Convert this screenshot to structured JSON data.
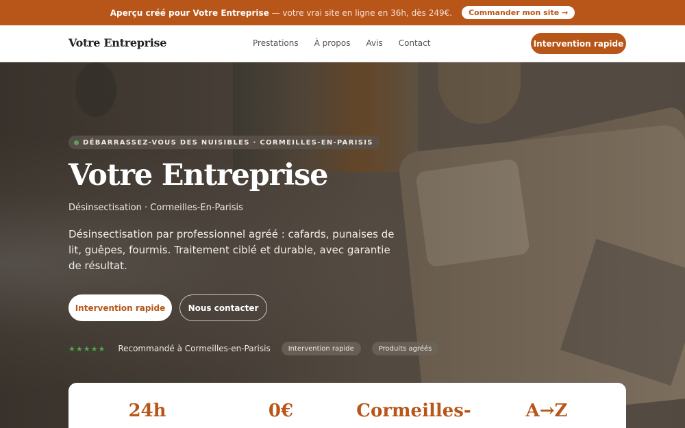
{
  "promo": {
    "lead": "Aperçu créé pour Votre Entreprise",
    "text": " — votre vrai site en ligne en 36h, dès 249€.",
    "cta": "Commander mon site →"
  },
  "nav": {
    "brand": "Votre Entreprise",
    "items": [
      "Prestations",
      "À propos",
      "Avis",
      "Contact"
    ],
    "cta": "Intervention rapide"
  },
  "hero": {
    "eyebrow": "DÉBARRASSEZ-VOUS DES NUISIBLES · CORMEILLES-EN-PARISIS",
    "title": "Votre Entreprise",
    "subtitle": "Désinsectisation · Cormeilles-En-Parisis",
    "description": "Désinsectisation par professionnel agréé : cafards, punaises de lit, guêpes, fourmis. Traitement ciblé et durable, avec garantie de résultat.",
    "primary_cta": "Intervention rapide",
    "secondary_cta": "Nous contacter",
    "stars": "★★★★★",
    "trust_text": "Recommandé à Cormeilles-en-Parisis",
    "chips": [
      "Intervention rapide",
      "Produits agréés"
    ]
  },
  "stats": [
    "24h",
    "0€",
    "Cormeilles-",
    "A→Z"
  ],
  "colors": {
    "accent": "#b8561a",
    "star": "#4fa64c"
  }
}
